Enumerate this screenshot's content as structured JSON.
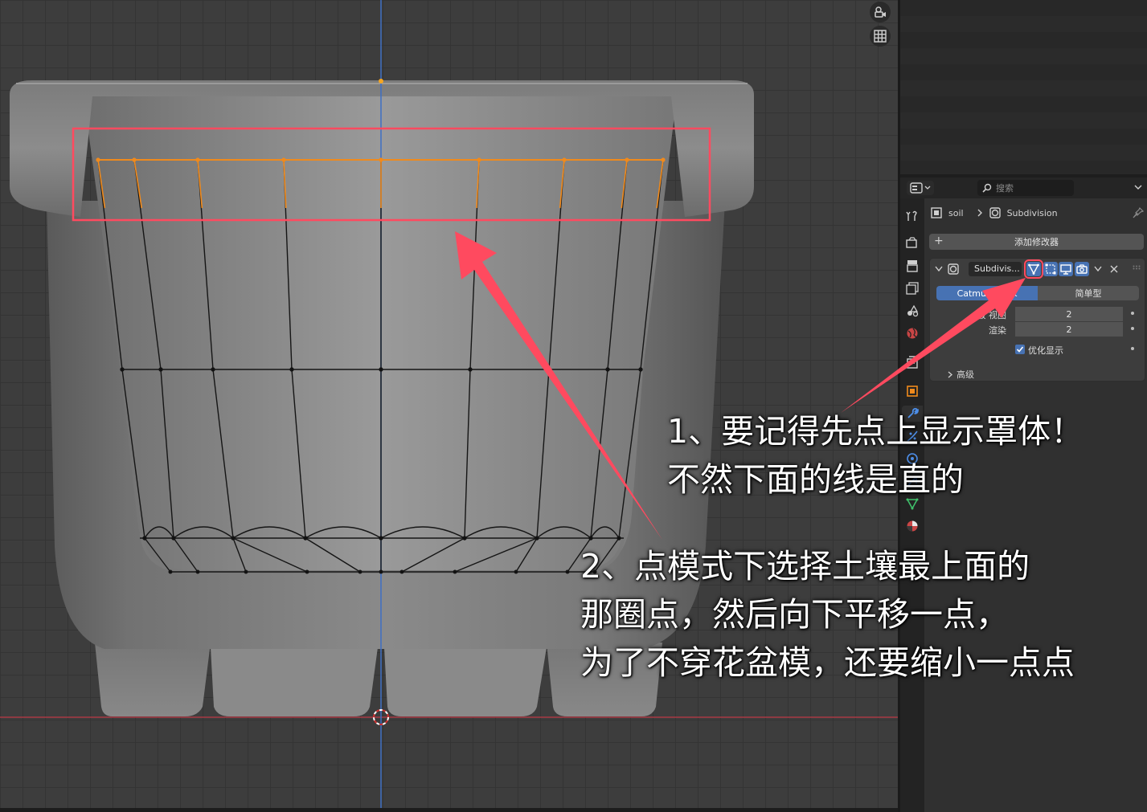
{
  "viewport": {
    "overlay_buttons": [
      {
        "icon": "camera-view-icon"
      },
      {
        "icon": "grid-toggle-icon"
      }
    ]
  },
  "properties": {
    "search_placeholder": "搜索",
    "breadcrumb": {
      "object": "soil",
      "modifier": "Subdivision"
    },
    "add_modifier_label": "添加修改器",
    "modifier": {
      "name": "Subdivis...",
      "mode_options": [
        "Catmull-Clark",
        "简单型"
      ],
      "mode_selected_label": "Catmull-Clark",
      "levels_viewport_label": "级 视图",
      "levels_viewport_value": "2",
      "render_label": "渲染",
      "render_value": "2",
      "optimal_display_label": "优化显示",
      "optimal_display_checked": true,
      "advanced_label": "高级"
    }
  },
  "annotations": {
    "note1_line1": "1、要记得先点上显示罩体！",
    "note1_line2": "不然下面的线是直的",
    "note2_line1": "2、点模式下选择土壤最上面的",
    "note2_line2": "那圈点，然后向下平移一点，",
    "note2_line3": "为了不穿花盆模，还要缩小一点点"
  },
  "colors": {
    "highlight_red": "#ff4a5f",
    "selected_orange": "#f08a1c",
    "active_blue": "#4772b3",
    "viewport_bg": "#3d3d3d",
    "x_axis_red": "#a83a44",
    "z_axis_blue": "#3e6fc4"
  }
}
